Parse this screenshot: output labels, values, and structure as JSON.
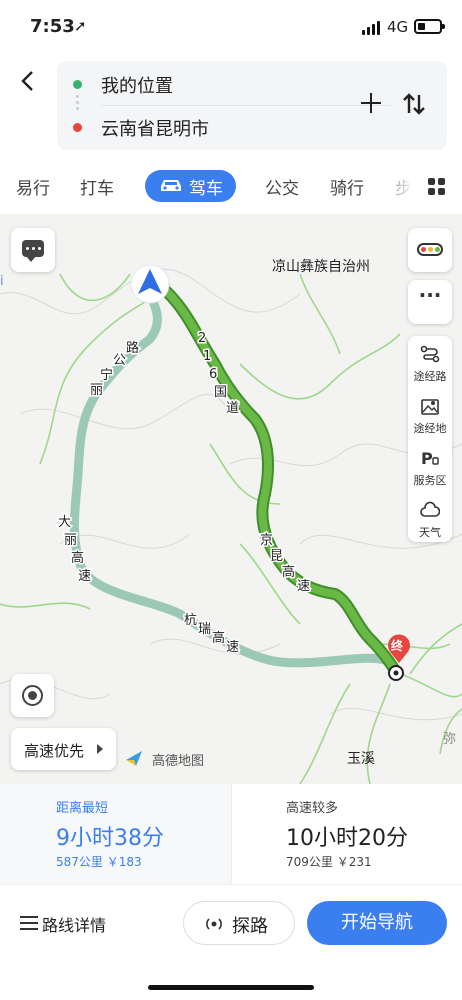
{
  "status_bar": {
    "time": "7:53",
    "network": "4G"
  },
  "route": {
    "origin": "我的位置",
    "destination": "云南省昆明市"
  },
  "modes": [
    {
      "label": "易行"
    },
    {
      "label": "打车"
    },
    {
      "label": "驾车",
      "active": true
    },
    {
      "label": "公交"
    },
    {
      "label": "骑行"
    },
    {
      "label": "步"
    }
  ],
  "map": {
    "road_labels": [
      "2",
      "1",
      "6",
      "国",
      "道",
      "京",
      "昆",
      "高",
      "速",
      "丽",
      "宁",
      "公",
      "路",
      "大",
      "丽",
      "高",
      "速",
      "杭",
      "瑞",
      "高",
      "速"
    ],
    "places": {
      "prefecture": "凉山彝族自治州",
      "city": "玉溪",
      "edge_right": "弥",
      "edge_left": "i"
    },
    "end_marker": "终",
    "side_tools": [
      "途经路",
      "途经地",
      "服务区",
      "天气"
    ],
    "route_preference": "高速优先",
    "logo": "高德地图",
    "colors": {
      "route_fast": "#6ab846",
      "route_alt": "#a9d3c4",
      "accent": "#3a7ef0"
    }
  },
  "route_options": [
    {
      "tag": "距离最短",
      "duration": "9小时38分",
      "meta": "587公里 ￥183",
      "selected": true
    },
    {
      "tag": "高速较多",
      "duration": "10小时20分",
      "meta": "709公里 ￥231",
      "selected": false
    }
  ],
  "actions": {
    "details": "路线详情",
    "explore": "探路",
    "start": "开始导航"
  }
}
